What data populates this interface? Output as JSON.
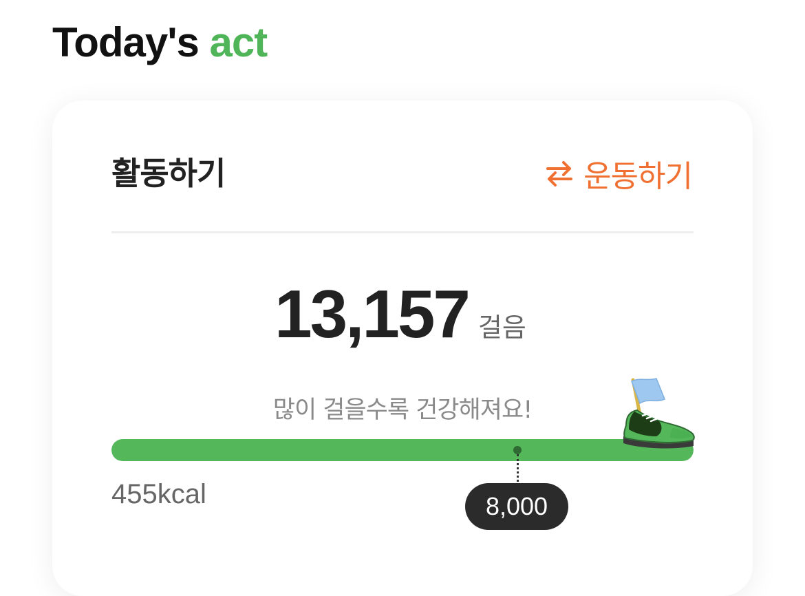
{
  "header": {
    "title_main": "Today's",
    "title_accent": "act"
  },
  "card": {
    "title": "활동하기",
    "switch_button_label": "운동하기",
    "steps": {
      "value": "13,157",
      "unit": "걸음"
    },
    "encouragement": "많이 걸을수록 건강해져요!",
    "progress": {
      "current_steps": 13157,
      "goal_label": "8,000",
      "goal_steps": 8000,
      "fill_fraction": 1.0
    },
    "calories": "455kcal"
  },
  "icons": {
    "switch": "swap-arrows-icon",
    "progress_end": "sneaker-with-flag-icon"
  },
  "colors": {
    "accent_green": "#54b85b",
    "title_green": "#4fb558",
    "switch_orange": "#f07032",
    "badge_dark": "#2b2b2b"
  }
}
